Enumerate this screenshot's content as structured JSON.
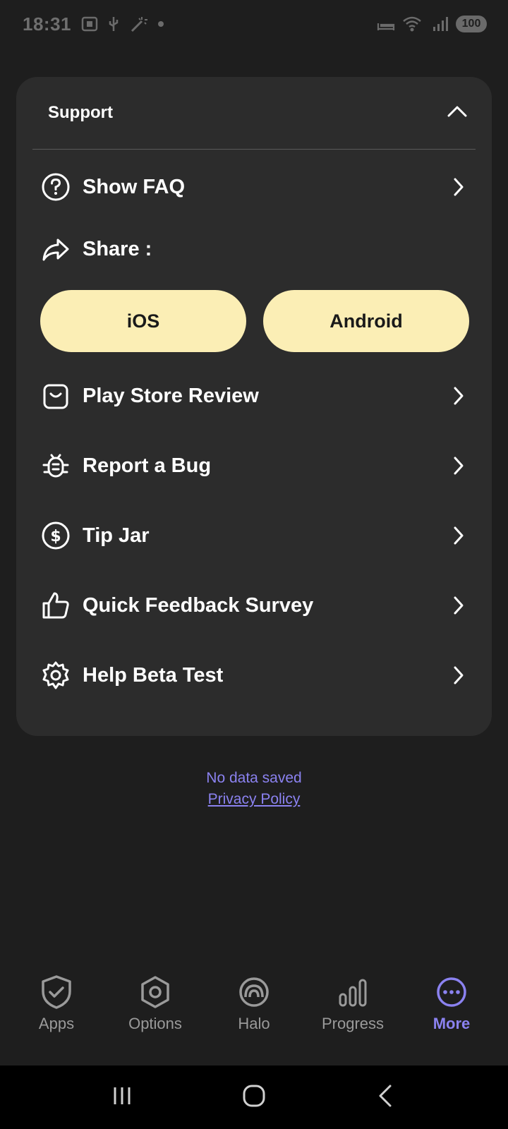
{
  "status_bar": {
    "time": "18:31",
    "battery": "100"
  },
  "support": {
    "title": "Support",
    "items": [
      {
        "label": "Show FAQ",
        "icon": "question-circle-icon"
      },
      {
        "label": "Share :",
        "icon": "share-arrow-icon"
      },
      {
        "label": "Play Store Review",
        "icon": "shopping-bag-icon"
      },
      {
        "label": "Report a Bug",
        "icon": "bug-icon"
      },
      {
        "label": "Tip Jar",
        "icon": "dollar-circle-icon"
      },
      {
        "label": "Quick Feedback Survey",
        "icon": "thumbs-up-icon"
      },
      {
        "label": "Help Beta Test",
        "icon": "gear-icon"
      }
    ],
    "share_buttons": [
      "iOS",
      "Android"
    ]
  },
  "footer": {
    "no_data": "No data saved",
    "privacy": "Privacy Policy"
  },
  "bottom_nav": [
    {
      "label": "Apps",
      "icon": "shield-check-icon",
      "active": false
    },
    {
      "label": "Options",
      "icon": "hexagon-icon",
      "active": false
    },
    {
      "label": "Halo",
      "icon": "halo-icon",
      "active": false
    },
    {
      "label": "Progress",
      "icon": "bar-chart-icon",
      "active": false
    },
    {
      "label": "More",
      "icon": "more-dots-icon",
      "active": true
    }
  ],
  "colors": {
    "background": "#1e1e1e",
    "card": "#2c2c2c",
    "pill": "#fbeeb5",
    "accent": "#8b82f0"
  }
}
